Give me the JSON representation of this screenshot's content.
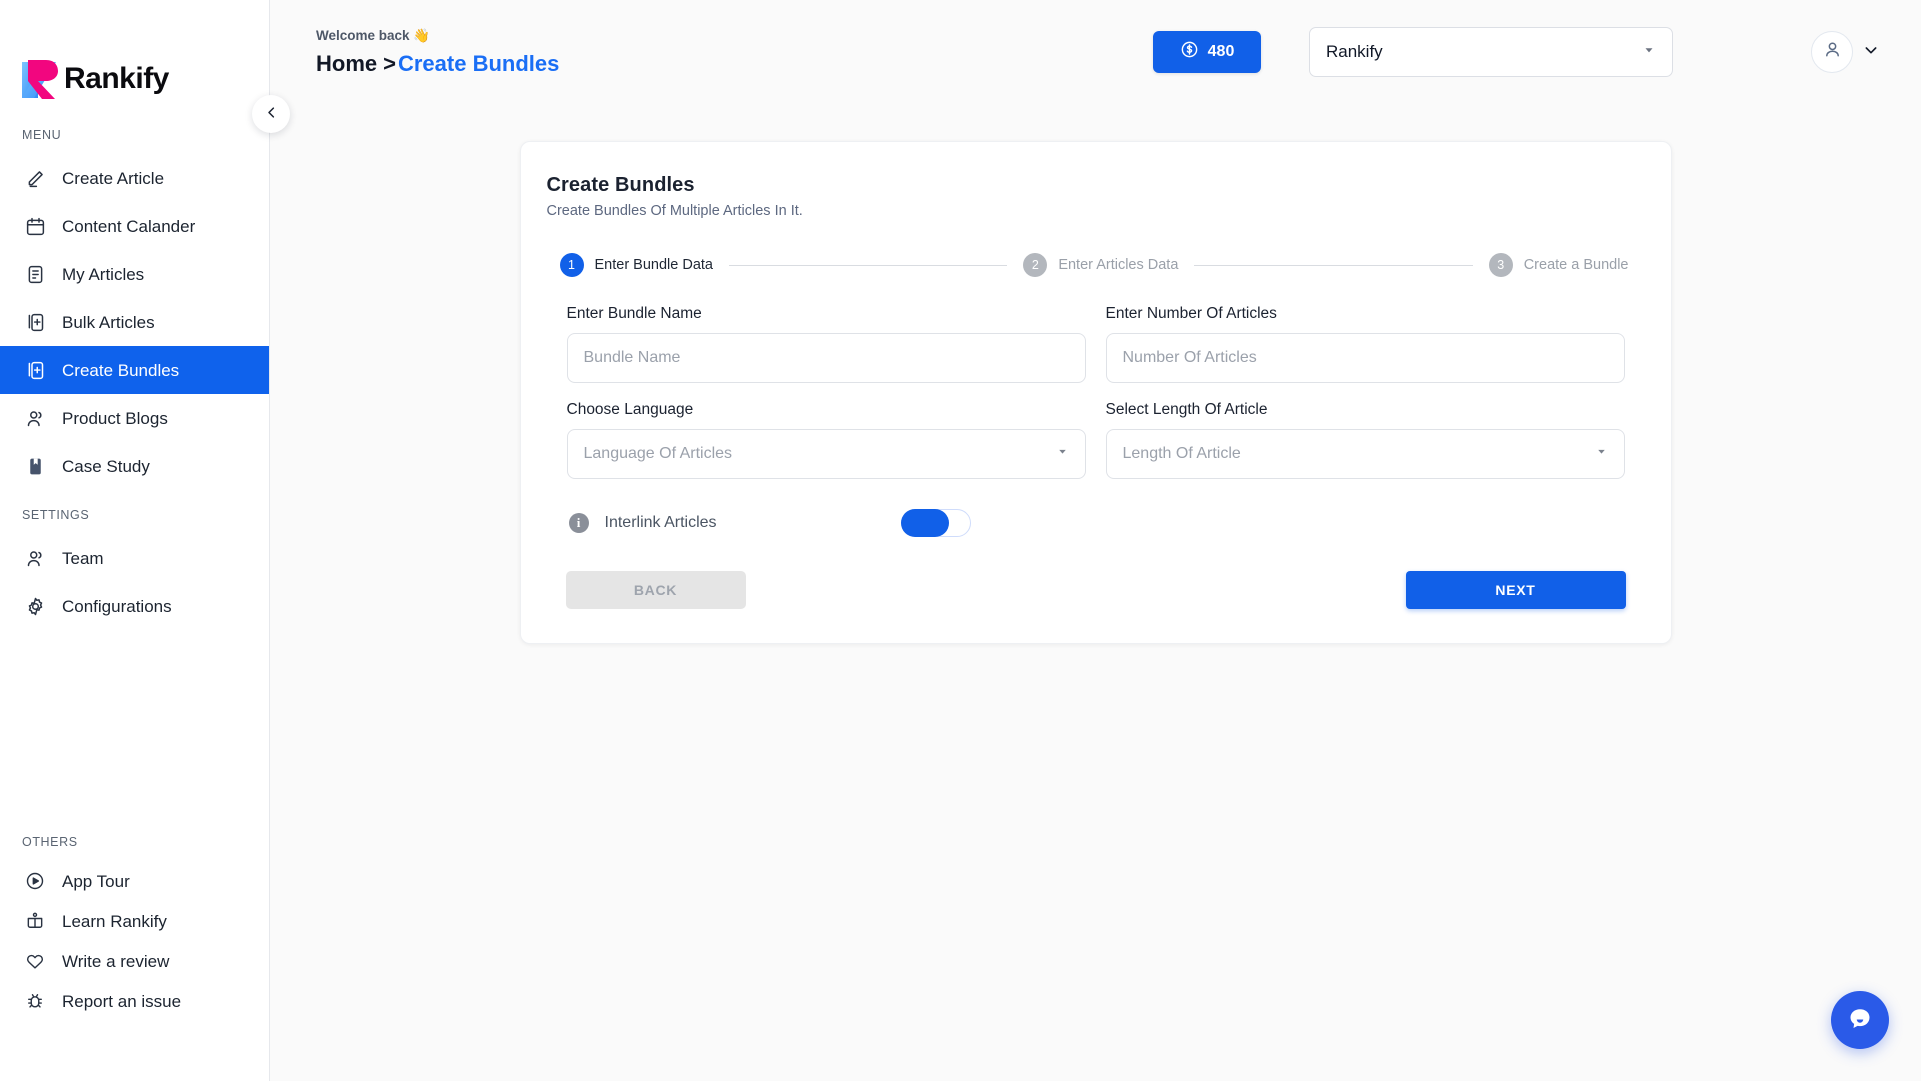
{
  "brand": {
    "name": "Rankify",
    "logo_icon": "rankify-logo-icon",
    "accent_blue": "#1160e8",
    "logo_pink": "#f2067f",
    "logo_blue": "#4aa7ff"
  },
  "sidebar": {
    "collapse_icon": "chevron-left-icon",
    "sections": [
      {
        "label": "MENU",
        "items": [
          {
            "label": "Create Article",
            "icon": "pencil-icon",
            "active": false
          },
          {
            "label": "Content Calander",
            "icon": "calendar-icon",
            "active": false
          },
          {
            "label": "My Articles",
            "icon": "document-icon",
            "active": false
          },
          {
            "label": "Bulk Articles",
            "icon": "documents-add-icon",
            "active": false
          },
          {
            "label": "Create Bundles",
            "icon": "documents-add-icon",
            "active": true
          },
          {
            "label": "Product Blogs",
            "icon": "users-icon",
            "active": false
          },
          {
            "label": "Case Study",
            "icon": "bookmark-book-icon",
            "active": false
          }
        ]
      },
      {
        "label": "SETTINGS",
        "items": [
          {
            "label": "Team",
            "icon": "users-icon",
            "active": false
          },
          {
            "label": "Configurations",
            "icon": "gear-icon",
            "active": false
          }
        ]
      },
      {
        "label": "OTHERS",
        "items": [
          {
            "label": "App Tour",
            "icon": "play-circle-icon",
            "active": false
          },
          {
            "label": "Learn Rankify",
            "icon": "open-book-icon",
            "active": false
          },
          {
            "label": "Write a review",
            "icon": "heart-icon",
            "active": false
          },
          {
            "label": "Report an issue",
            "icon": "bug-icon",
            "active": false
          }
        ]
      }
    ]
  },
  "topbar": {
    "welcome_text": "Welcome back 👋",
    "breadcrumb_home": "Home",
    "breadcrumb_separator": ">",
    "breadcrumb_current": "Create Bundles",
    "credits": {
      "value": "480",
      "icon": "dollar-circle-icon"
    },
    "workspace": {
      "selected": "Rankify",
      "caret_icon": "chevron-down-icon"
    },
    "avatar_icon": "user-avatar-icon",
    "avatar_caret_icon": "chevron-down-icon"
  },
  "card": {
    "title": "Create Bundles",
    "subtitle": "Create Bundles Of Multiple Articles In It.",
    "steps": [
      {
        "number": "1",
        "label": "Enter Bundle Data",
        "active": true
      },
      {
        "number": "2",
        "label": "Enter Articles Data",
        "active": false
      },
      {
        "number": "3",
        "label": "Create a Bundle",
        "active": false
      }
    ],
    "fields": {
      "bundle_name": {
        "label": "Enter Bundle Name",
        "placeholder": "Bundle Name",
        "value": ""
      },
      "number_articles": {
        "label": "Enter Number Of Articles",
        "placeholder": "Number Of Articles",
        "value": ""
      },
      "language": {
        "label": "Choose Language",
        "placeholder": "Language Of Articles",
        "value": "",
        "caret_icon": "chevron-down-icon"
      },
      "length": {
        "label": "Select Length Of Article",
        "placeholder": "Length Of Article",
        "value": "",
        "caret_icon": "chevron-down-icon"
      }
    },
    "interlink": {
      "info_icon": "info-icon",
      "info_glyph": "i",
      "label": "Interlink Articles",
      "enabled": true
    },
    "actions": {
      "back_label": "BACK",
      "next_label": "NEXT"
    }
  },
  "chat_widget": {
    "icon": "chat-bubble-icon"
  }
}
